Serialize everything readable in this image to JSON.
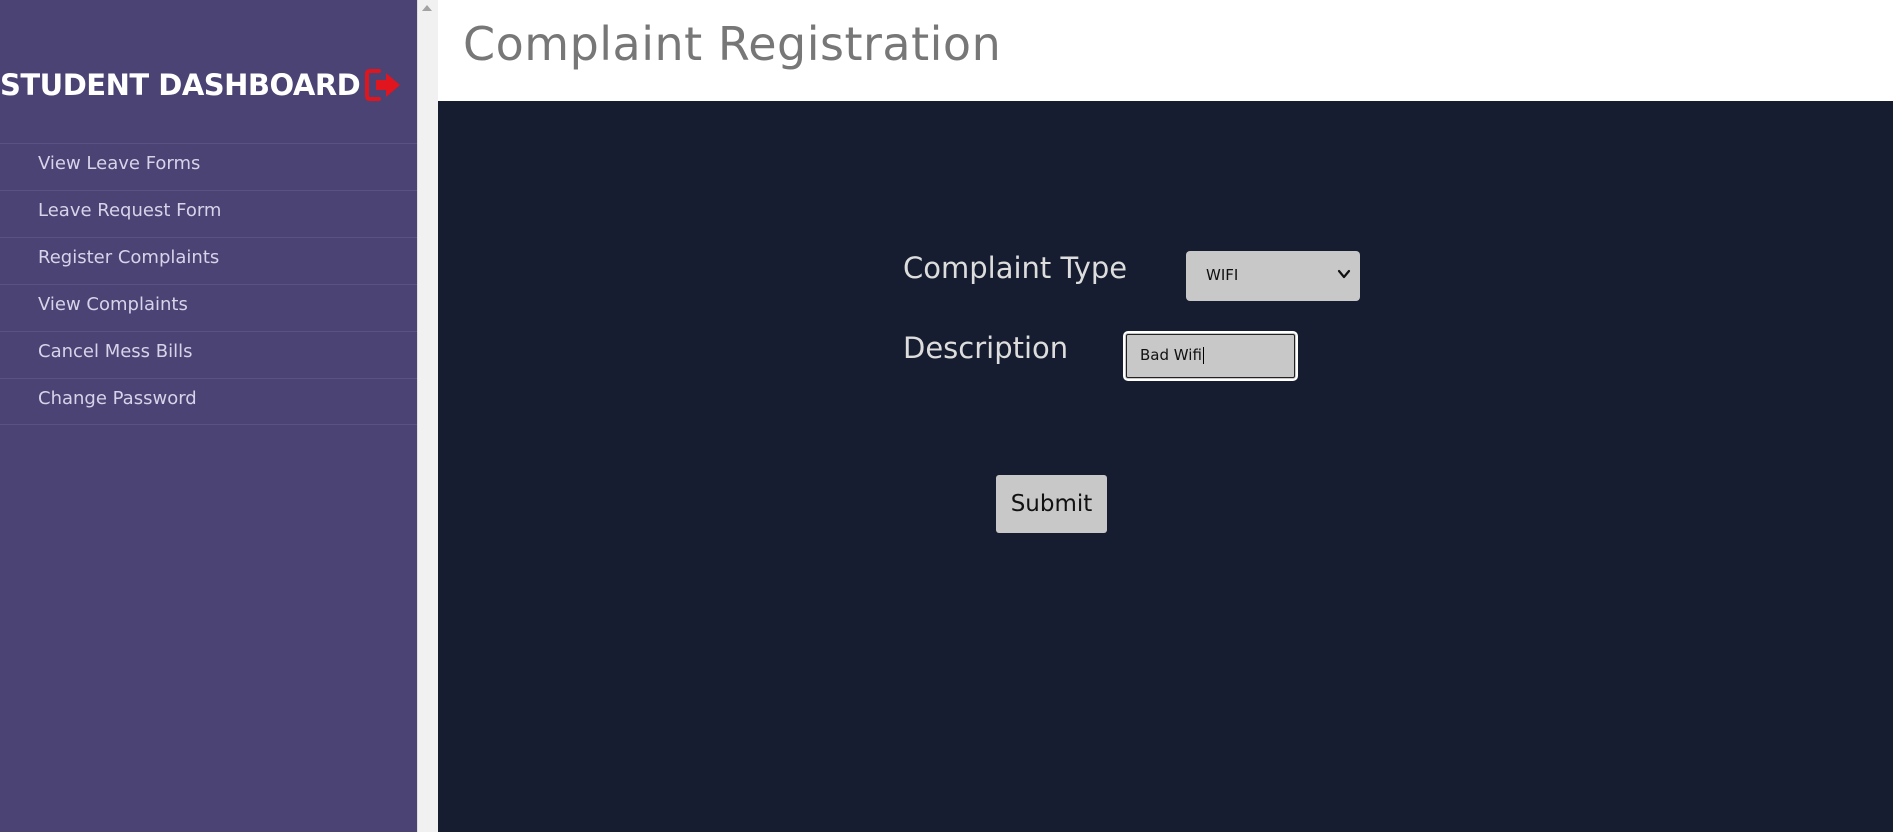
{
  "sidebar": {
    "title": "STUDENT DASHBOARD",
    "logout_icon": "logout-icon",
    "logout_color": "#e0151e",
    "items": [
      {
        "label": "View Leave Forms"
      },
      {
        "label": "Leave Request Form"
      },
      {
        "label": "Register Complaints"
      },
      {
        "label": "View Complaints"
      },
      {
        "label": "Cancel Mess Bills"
      },
      {
        "label": "Change Password"
      }
    ]
  },
  "header": {
    "title": "Complaint Registration"
  },
  "form": {
    "complaint_type_label": "Complaint Type",
    "complaint_type_value": "WIFI",
    "description_label": "Description",
    "description_value": "Bad Wifi",
    "submit_label": "Submit"
  },
  "colors": {
    "sidebar_bg": "#4b4373",
    "content_bg": "#161d30",
    "field_bg": "#c8c8c8"
  }
}
